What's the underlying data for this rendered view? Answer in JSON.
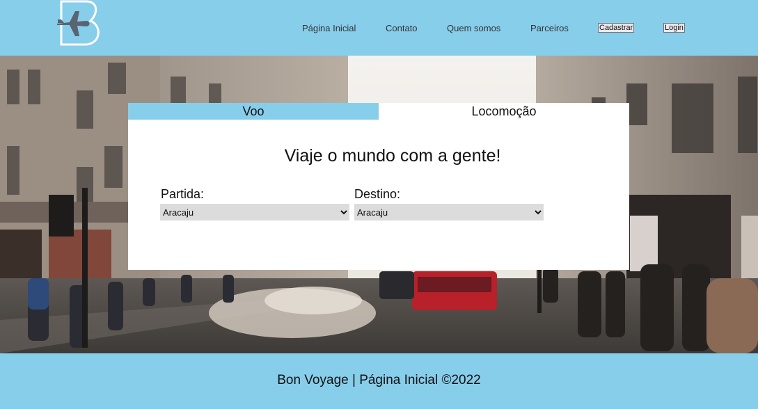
{
  "colors": {
    "brand_blue": "#87ceeb",
    "panel_bg": "#ffffff",
    "select_bg": "#dcdcdc",
    "logo_dark": "#5a6470"
  },
  "header": {
    "logo_icon": "airplane-b-logo",
    "nav": {
      "home": "Página Inicial",
      "contact": "Contato",
      "about": "Quem somos",
      "partners": "Parceiros"
    },
    "buttons": {
      "register": "Cadastrar",
      "login": "Login"
    }
  },
  "booking": {
    "tabs": {
      "flight": "Voo",
      "transport": "Locomoção"
    },
    "title": "Viaje o mundo com a gente!",
    "origin": {
      "label": "Partida:",
      "selected": "Aracaju"
    },
    "destination": {
      "label": "Destino:",
      "selected": "Aracaju"
    }
  },
  "footer": {
    "text": "Bon Voyage | Página Inicial ©2022"
  }
}
